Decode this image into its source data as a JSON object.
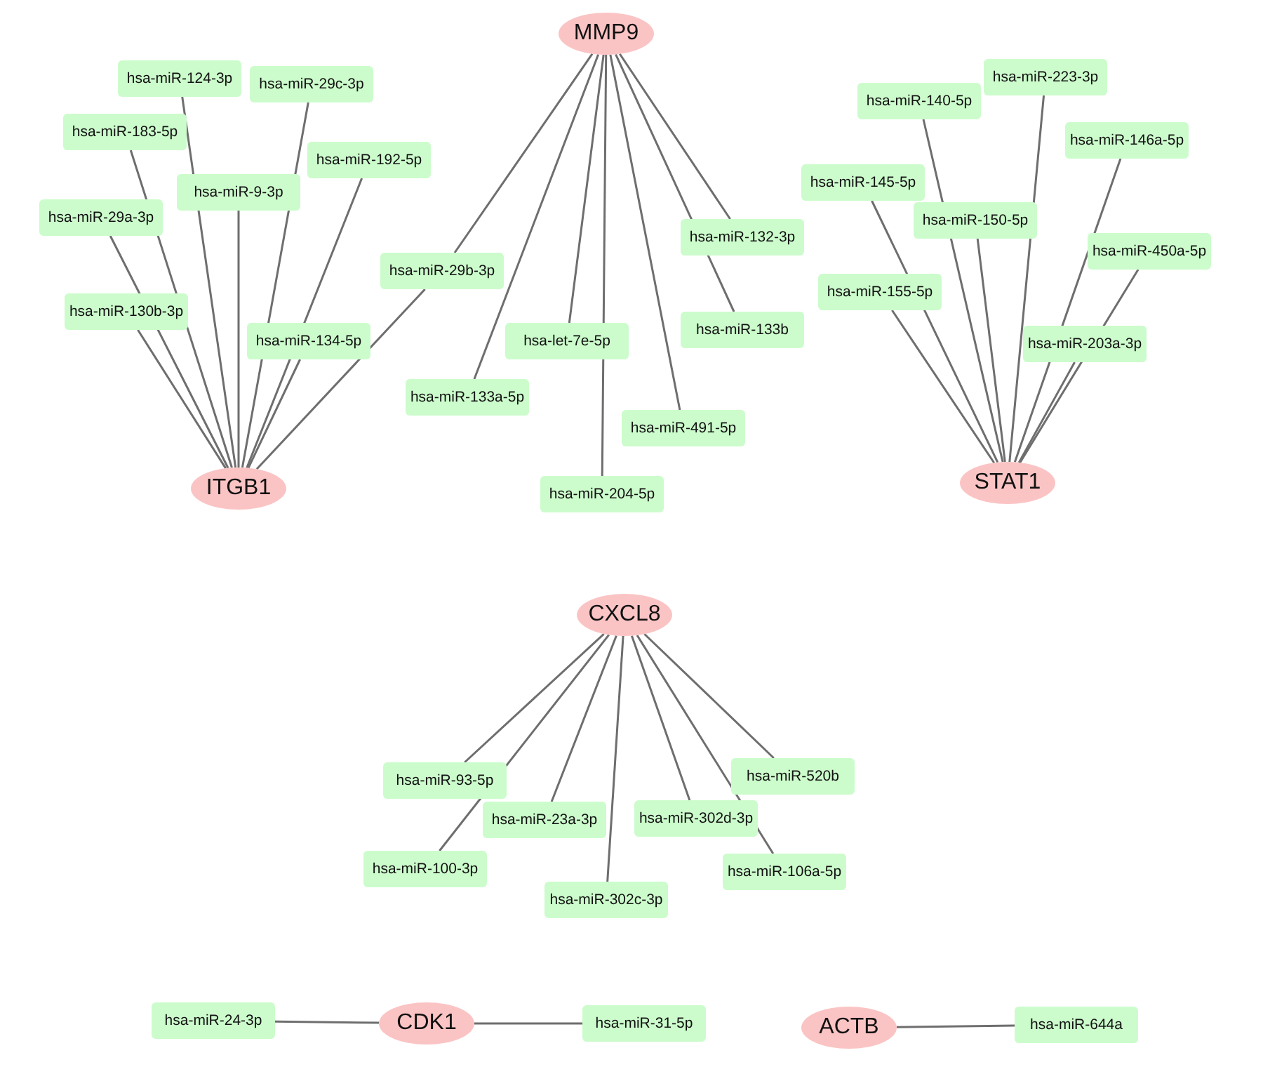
{
  "clusters": [
    {
      "gene": "MMP9",
      "targets": [
        "hsa-miR-29b-3p",
        "hsa-miR-133a-5p",
        "hsa-let-7e-5p",
        "hsa-miR-204-5p",
        "hsa-miR-491-5p",
        "hsa-miR-132-3p",
        "hsa-miR-133b"
      ]
    },
    {
      "gene": "ITGB1",
      "targets": [
        "hsa-miR-124-3p",
        "hsa-miR-29c-3p",
        "hsa-miR-183-5p",
        "hsa-miR-192-5p",
        "hsa-miR-9-3p",
        "hsa-miR-29a-3p",
        "hsa-miR-130b-3p",
        "hsa-miR-134-5p"
      ]
    },
    {
      "gene": "STAT1",
      "targets": [
        "hsa-miR-223-3p",
        "hsa-miR-140-5p",
        "hsa-miR-146a-5p",
        "hsa-miR-145-5p",
        "hsa-miR-150-5p",
        "hsa-miR-450a-5p",
        "hsa-miR-155-5p",
        "hsa-miR-203a-3p"
      ]
    },
    {
      "gene": "CXCL8",
      "targets": [
        "hsa-miR-93-5p",
        "hsa-miR-520b",
        "hsa-miR-23a-3p",
        "hsa-miR-302d-3p",
        "hsa-miR-100-3p",
        "hsa-miR-106a-5p",
        "hsa-miR-302c-3p"
      ]
    },
    {
      "gene": "CDK1",
      "targets": [
        "hsa-miR-24-3p",
        "hsa-miR-31-5p"
      ]
    },
    {
      "gene": "ACTB",
      "targets": [
        "hsa-miR-644a"
      ]
    }
  ]
}
